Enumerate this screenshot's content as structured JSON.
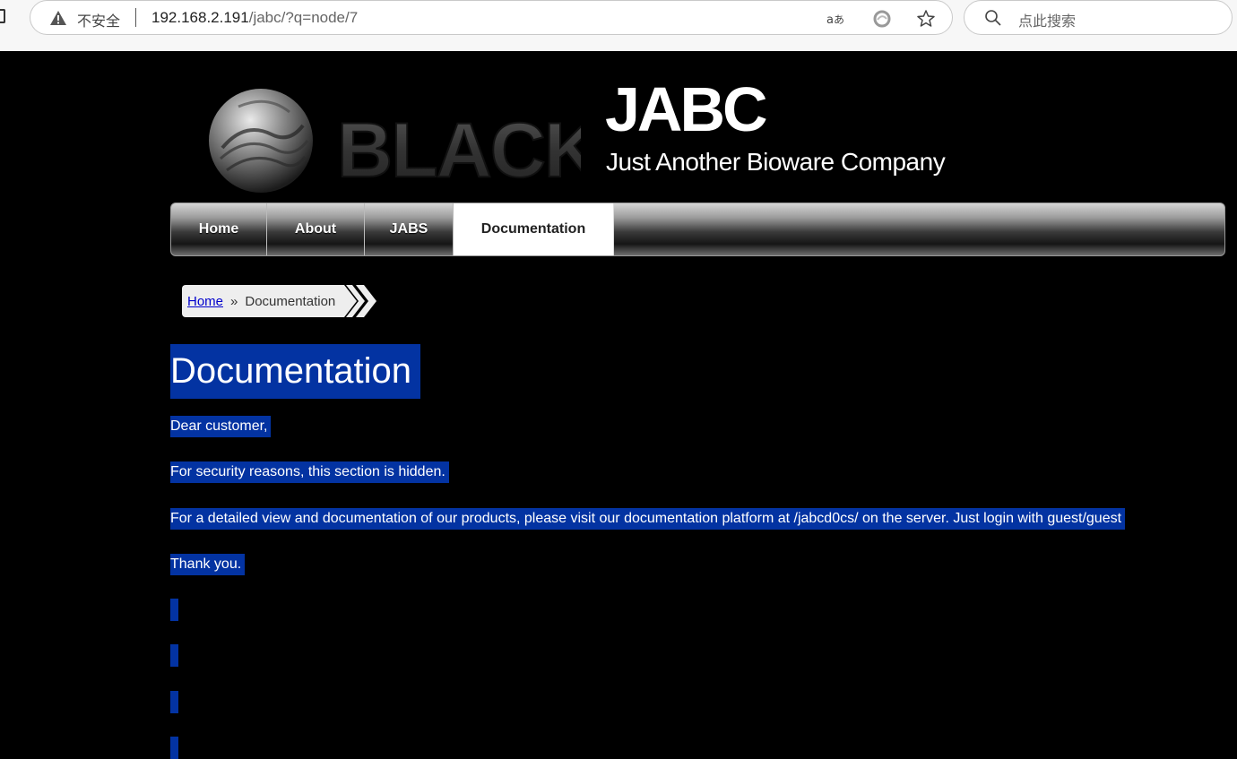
{
  "browser": {
    "security_label": "不安全",
    "url_host": "192.168.2.191",
    "url_path": "/jabc/?q=node/7",
    "search_placeholder": "点此搜索"
  },
  "header": {
    "site_name": "JABC",
    "site_slogan": "Just Another Bioware Company",
    "logo_text": "BLACK"
  },
  "nav": {
    "items": [
      {
        "label": "Home",
        "active": false
      },
      {
        "label": "About",
        "active": false
      },
      {
        "label": "JABS",
        "active": false
      },
      {
        "label": "Documentation",
        "active": true
      }
    ]
  },
  "breadcrumb": {
    "home": "Home",
    "separator": "»",
    "current": "Documentation"
  },
  "content": {
    "title": "Documentation",
    "paragraphs": [
      "Dear customer,",
      "For security reasons, this section is hidden.",
      "For a detailed view and documentation of our products, please visit our documentation platform at /jabcd0cs/ on the server. Just login with guest/guest",
      "Thank you."
    ]
  },
  "colors": {
    "selection": "#0333a2",
    "page_background": "#000000",
    "link": "#0000cc"
  }
}
